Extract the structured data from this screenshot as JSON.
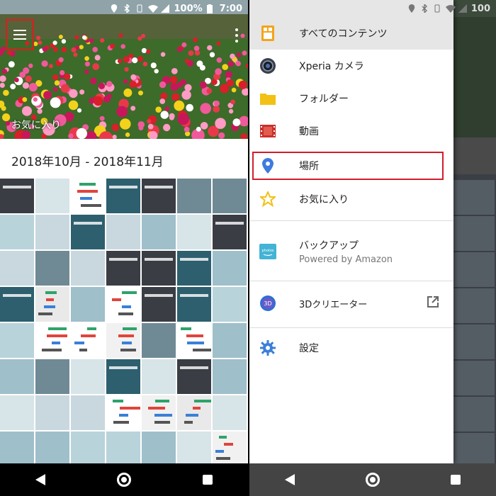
{
  "status_bar": {
    "battery": "100%",
    "time": "7:00",
    "network": "LTE"
  },
  "left_screen": {
    "hero_label": "お気に入り",
    "date_range": "2018年10月 - 2018年11月",
    "icons": {
      "menu": "hamburger-icon",
      "more": "more-vert-icon"
    }
  },
  "right_screen": {
    "status_battery": "100",
    "drawer_items": [
      {
        "label": "すべてのコンテンツ",
        "icon": "all-content-icon",
        "selected": true
      },
      {
        "label": "Xperia カメラ",
        "icon": "camera-lens-icon"
      },
      {
        "label": "フォルダー",
        "icon": "folder-icon"
      },
      {
        "label": "動画",
        "icon": "film-strip-icon"
      },
      {
        "label": "場所",
        "icon": "location-pin-icon",
        "highlighted": true
      },
      {
        "label": "お気に入り",
        "icon": "star-icon"
      },
      {
        "label": "バックアップ",
        "sublabel": "Powered by Amazon",
        "icon": "amazon-photos-icon"
      },
      {
        "label": "3Dクリエーター",
        "icon": "3d-creator-icon"
      },
      {
        "label": "設定",
        "icon": "gear-icon"
      }
    ],
    "icon_badges": {
      "amazon_photos": "photos",
      "three_d": "3D"
    }
  },
  "colors": {
    "highlight": "#d01e2b",
    "folder": "#f2c114",
    "pin": "#3d7be0",
    "star": "#f2c114",
    "gear": "#3b7fd9",
    "all_content": "#f5a31a"
  }
}
